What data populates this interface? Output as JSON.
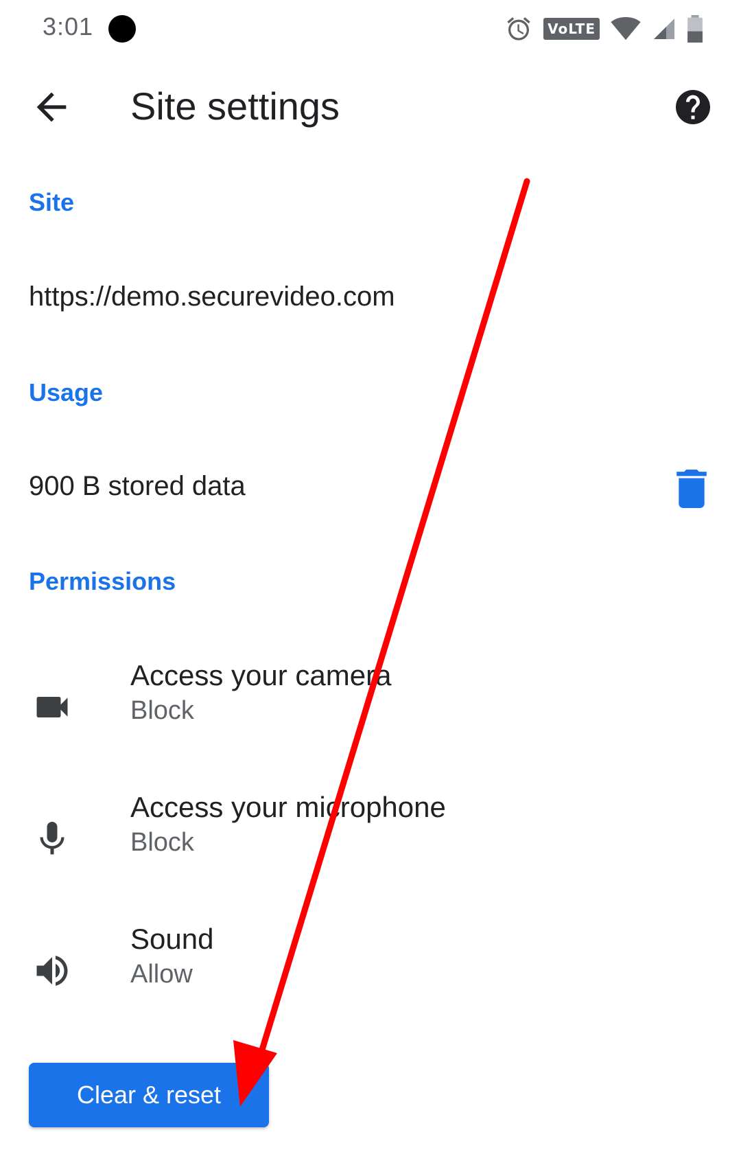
{
  "status_bar": {
    "time": "3:01",
    "network_badge": "VoLTE",
    "icons": [
      "alarm-icon",
      "volte-icon",
      "wifi-icon",
      "signal-icon",
      "battery-icon"
    ]
  },
  "app_bar": {
    "title": "Site settings",
    "back_icon": "arrow-back-icon",
    "help_icon": "help-icon"
  },
  "sections": {
    "site": {
      "header": "Site",
      "url": "https://demo.securevideo.com"
    },
    "usage": {
      "header": "Usage",
      "stored_data": "900 B stored data",
      "delete_icon": "trash-icon"
    },
    "permissions": {
      "header": "Permissions",
      "items": [
        {
          "title": "Access your camera",
          "value": "Block",
          "icon": "camera-icon"
        },
        {
          "title": "Access your microphone",
          "value": "Block",
          "icon": "microphone-icon"
        },
        {
          "title": "Sound",
          "value": "Allow",
          "icon": "volume-icon"
        }
      ]
    }
  },
  "actions": {
    "clear_reset_label": "Clear & reset"
  },
  "colors": {
    "accent": "#1a73e8",
    "annotation_arrow": "#ff0000",
    "primary_text": "#202124",
    "secondary_text": "#5f6368"
  }
}
